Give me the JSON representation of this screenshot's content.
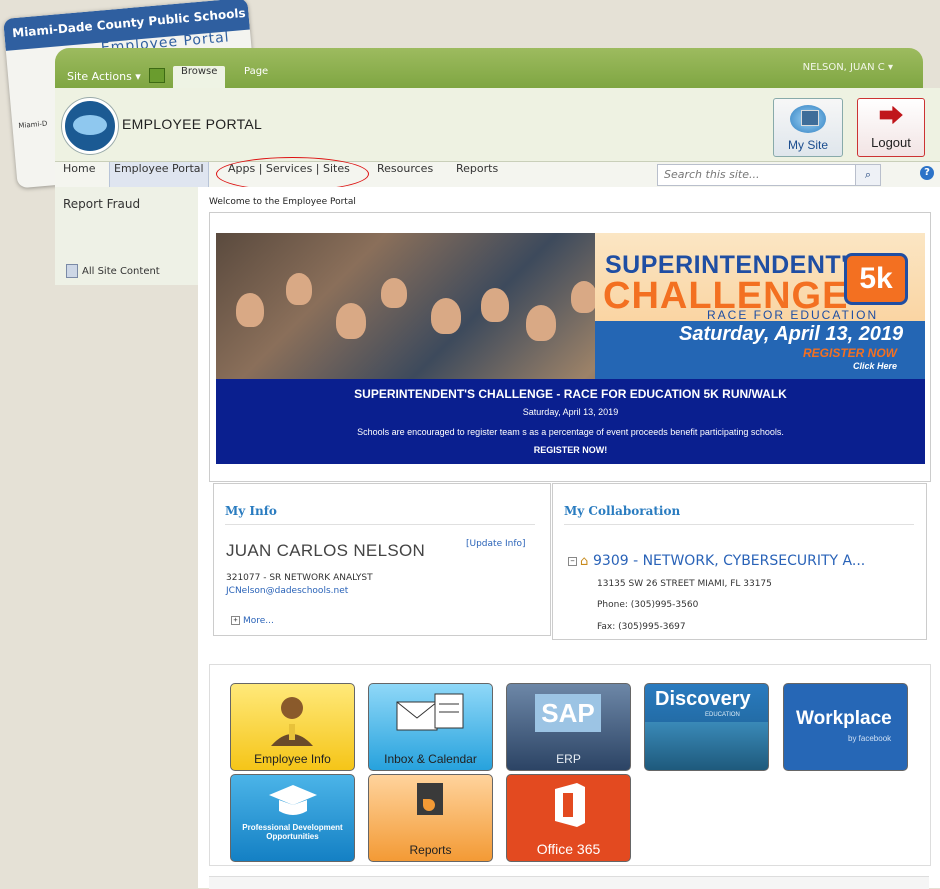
{
  "id_card": {
    "line1": "Miami-Dade County Public Schools",
    "line2": "Employee Portal",
    "line3": "Miami-D"
  },
  "ribbon": {
    "site_actions": "Site Actions ▾",
    "tab_browse": "Browse",
    "tab_page": "Page",
    "user": "NELSON, JUAN C ▾"
  },
  "header": {
    "portal_title": "EMPLOYEE PORTAL",
    "my_site": "My Site",
    "logout": "Logout"
  },
  "nav": {
    "items": [
      "Home",
      "Employee Portal",
      "Apps | Services | Sites",
      "Resources",
      "Reports"
    ],
    "search_placeholder": "Search this site...",
    "help": "?"
  },
  "sidebar": {
    "report_fraud": "Report Fraud",
    "all_site_content": "All Site Content"
  },
  "main": {
    "welcome": "Welcome to the Employee Portal"
  },
  "banner": {
    "promo_line1": "SUPERINTENDENT'S",
    "promo_line2": "CHALLENGE",
    "promo_badge": "5k",
    "promo_line3": "RACE FOR EDUCATION",
    "promo_date": "Saturday, April 13, 2019",
    "promo_register": "REGISTER NOW",
    "promo_click": "Click Here",
    "headline": "SUPERINTENDENT'S CHALLENGE - RACE FOR EDUCATION 5K RUN/WALK",
    "date": "Saturday, April 13, 2019",
    "subtext": "Schools are encouraged to register team s as a percentage of event proceeds benefit participating schools.",
    "cta": "REGISTER NOW!"
  },
  "my_info": {
    "title": "My Info",
    "name": "JUAN CARLOS NELSON",
    "update": "[Update Info]",
    "role": "321077 - SR NETWORK ANALYST",
    "email": "JCNelson@dadeschools.net",
    "more": "More..."
  },
  "my_collab": {
    "title": "My Collaboration",
    "site": "9309 - NETWORK, CYBERSECURITY A...",
    "address": "13135 SW 26 STREET MIAMI, FL 33175",
    "phone": "Phone: (305)995-3560",
    "fax": "Fax: (305)995-3697"
  },
  "tiles": {
    "employee_info": "Employee Info",
    "inbox": "Inbox & Calendar",
    "erp": "ERP",
    "sap": "SAP",
    "discovery": "Discovery",
    "discovery_sub": "EDUCATION",
    "workplace": "Workplace",
    "workplace_sub": "by facebook",
    "prof_dev": "Professional Development Opportunities",
    "reports": "Reports",
    "office365": "Office 365"
  },
  "colors": {
    "ribbon_green": "#8fb04f",
    "accent_blue": "#2a7cc0",
    "banner_navy": "#0a1f8f",
    "logout_red": "#c0161b"
  }
}
